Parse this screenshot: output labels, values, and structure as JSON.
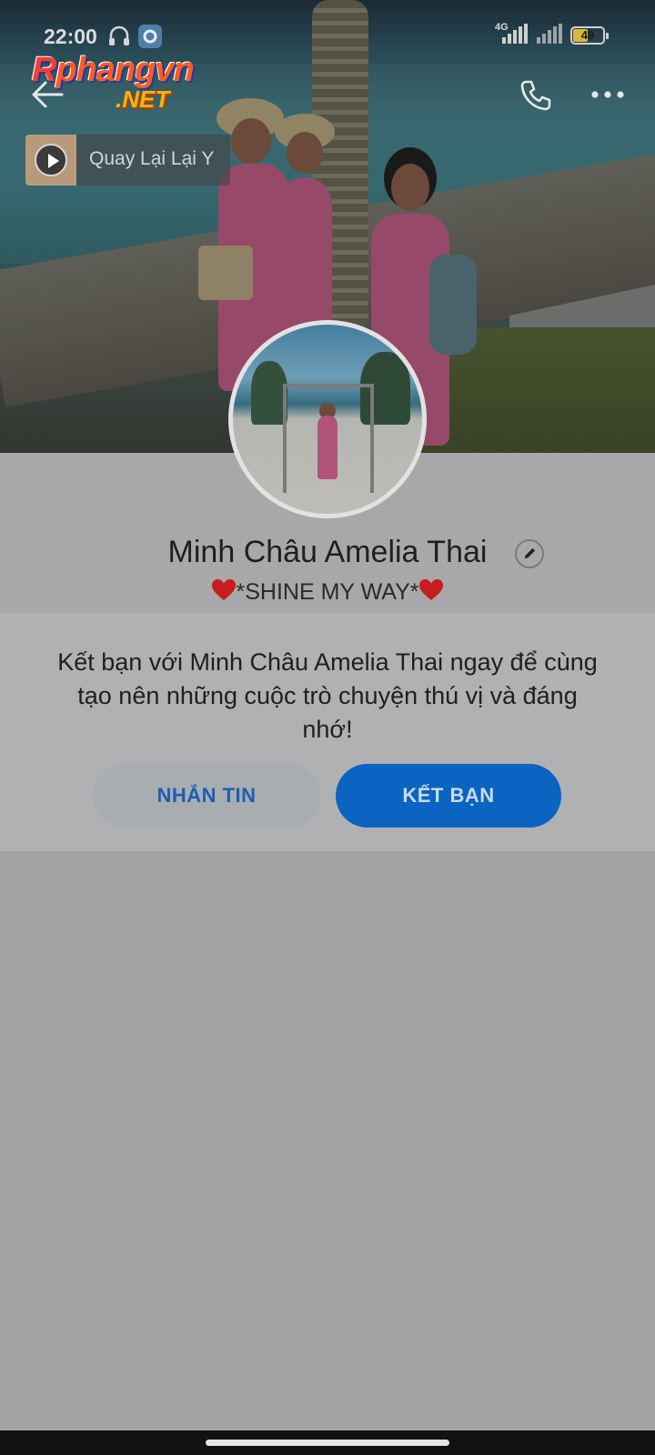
{
  "status_bar": {
    "time": "22:00",
    "network": "4G",
    "battery": "49",
    "battery_level": 0.49
  },
  "watermark": {
    "line1_first": "R",
    "line1_rest": "phangvn",
    "line2": ".NET"
  },
  "header": {
    "back_icon": "arrow-left-icon",
    "call_icon": "phone-icon",
    "more_icon": "more-dots-icon"
  },
  "music": {
    "title": "Quay Lại Lại Y",
    "icon": "play-icon"
  },
  "profile": {
    "name": "Minh Châu Amelia Thai",
    "status": "*SHINE MY WAY*",
    "status_decoration": "heart-icon"
  },
  "friend_prompt": {
    "text": "Kết bạn với Minh Châu Amelia Thai ngay để cùng tạo nên những cuộc trò chuyện thú vị và đáng nhớ!",
    "message_button": "NHẮN TIN",
    "add_friend_button": "KẾT BẠN"
  },
  "colors": {
    "primary": "#0b63c2",
    "background": "#a3a3a5",
    "heart": "#c81d1d"
  }
}
